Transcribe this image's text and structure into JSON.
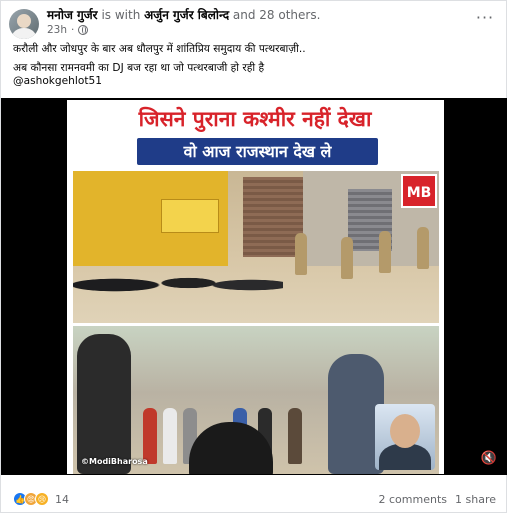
{
  "post": {
    "author": "मनोज गुर्जर",
    "with_text": "is with",
    "tagged": "अर्जुन गुर्जर बिलोन्द",
    "others": "and 28 others.",
    "time": "23h",
    "more_label": "···",
    "lines": [
      "करौली और जोधपुर के बार अब धौलपुर में शांतिप्रिय समुदाय की पत्थरबाज़ी..",
      "अब कौनसा रामनवमी का DJ बज रहा था जो पत्थरबाजी हो रही है",
      "@ashokgehlot51"
    ]
  },
  "video": {
    "title_line1": "जिसने पुराना कश्मीर नहीं देखा",
    "title_line2": "वो आज राजस्थान देख ले",
    "logo": "MB",
    "watermark": "©ModiBharosa",
    "mute_icon": "speaker-muted-icon"
  },
  "footer": {
    "reactions": [
      "like-icon",
      "angry-icon",
      "sad-icon"
    ],
    "reaction_count": "14",
    "comments": "2 comments",
    "shares": "1 share"
  },
  "colors": {
    "title_red": "#d8232a",
    "title_blue_bg": "#1f3c88",
    "like_blue": "#1877f2"
  }
}
